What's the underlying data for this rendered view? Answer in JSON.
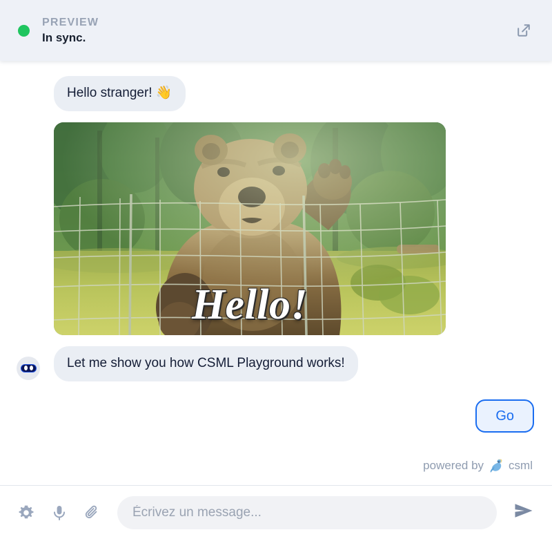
{
  "header": {
    "eyebrow": "PREVIEW",
    "title": "In sync.",
    "status_color": "#1fc55f",
    "open_icon": "external-link-icon"
  },
  "chat": {
    "messages": [
      {
        "type": "text",
        "sender": "bot",
        "text": "Hello stranger! 👋"
      },
      {
        "type": "image",
        "sender": "bot",
        "alt": "bear waving behind a wire fence",
        "caption": "Hello!"
      },
      {
        "type": "text",
        "sender": "bot",
        "text": "Let me show you how CSML Playground works!",
        "avatar": "bot-avatar"
      }
    ],
    "quick_replies": [
      {
        "label": "Go",
        "border_color": "#1a6df0",
        "text_color": "#1a6df0",
        "fill_color": "#eaf2fe"
      }
    ],
    "bubble_color": "#eaeef4",
    "bubble_text_color": "#141d36"
  },
  "footer": {
    "powered_by_text": "powered by",
    "brand_name": "csml",
    "logo_icon": "csml-bird-logo"
  },
  "composer": {
    "tools": [
      {
        "icon": "gear-icon",
        "name": "settings"
      },
      {
        "icon": "microphone-icon",
        "name": "voice"
      },
      {
        "icon": "paperclip-icon",
        "name": "attachment"
      }
    ],
    "input_placeholder": "Écrivez un message...",
    "input_value": "",
    "send_icon": "send-icon"
  }
}
